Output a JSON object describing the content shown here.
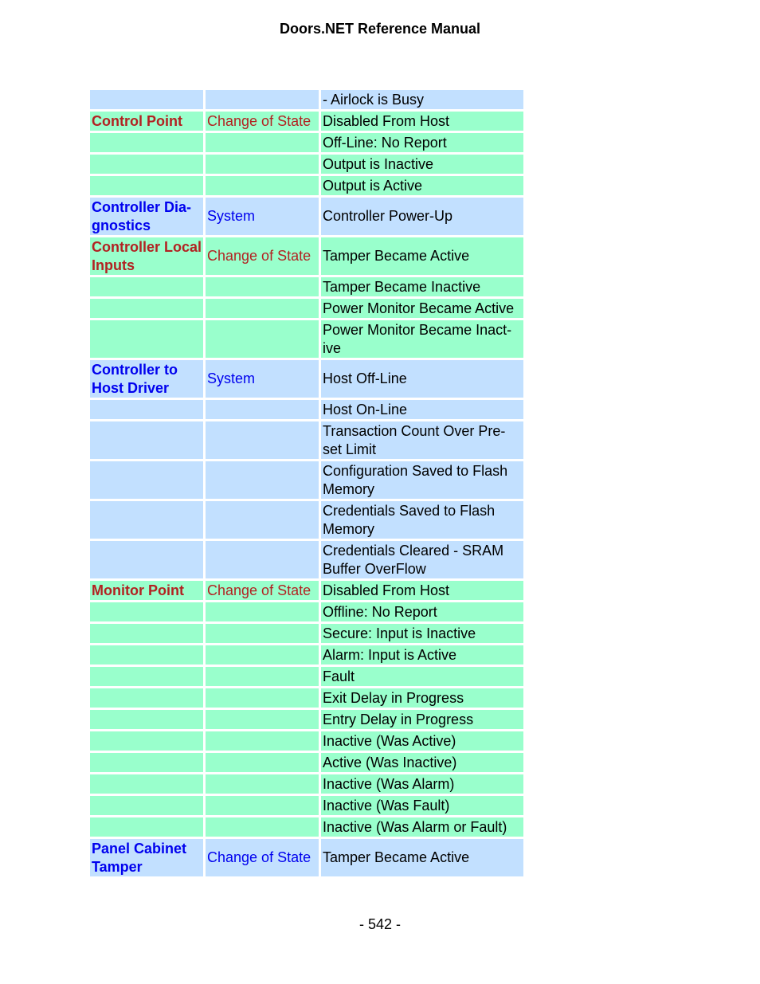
{
  "header": {
    "title": "Doors.NET Reference Manual"
  },
  "footer": {
    "page_number": "- 542 -"
  },
  "colors": {
    "blue_row": "#c2e0ff",
    "green_row": "#99ffcc",
    "red_text": "#b22222",
    "blue_text": "#0000ee"
  },
  "rows": [
    {
      "type": "",
      "category": "",
      "event": "- Airlock is Busy",
      "color": "blue"
    },
    {
      "type": "Control Point",
      "category": "Change of State",
      "event": "Disabled From Host",
      "color": "green"
    },
    {
      "type": "",
      "category": "",
      "event": "Off-Line: No Report",
      "color": "green"
    },
    {
      "type": "",
      "category": "",
      "event": "Output is Inactive",
      "color": "green"
    },
    {
      "type": "",
      "category": "",
      "event": "Output is Active",
      "color": "green"
    },
    {
      "type": "Controller Dia-gnostics",
      "category": "System",
      "event": "Controller Power-Up",
      "color": "blue"
    },
    {
      "type": "Controller Local Inputs",
      "category": "Change of State",
      "event": "Tamper Became Active",
      "color": "green"
    },
    {
      "type": "",
      "category": "",
      "event": "Tamper Became Inactive",
      "color": "green"
    },
    {
      "type": "",
      "category": "",
      "event": "Power Monitor Became Active",
      "color": "green"
    },
    {
      "type": "",
      "category": "",
      "event": "Power Monitor Became Inact-ive",
      "color": "green"
    },
    {
      "type": "Controller to Host Driver",
      "category": "System",
      "event": "Host Off-Line",
      "color": "blue"
    },
    {
      "type": "",
      "category": "",
      "event": "Host On-Line",
      "color": "blue"
    },
    {
      "type": "",
      "category": "",
      "event": "Transaction Count Over Pre-set Limit",
      "color": "blue"
    },
    {
      "type": "",
      "category": "",
      "event": "Configuration Saved to Flash Memory",
      "color": "blue"
    },
    {
      "type": "",
      "category": "",
      "event": "Credentials Saved to Flash Memory",
      "color": "blue"
    },
    {
      "type": "",
      "category": "",
      "event": "Credentials Cleared - SRAM Buffer OverFlow",
      "color": "blue"
    },
    {
      "type": "Monitor Point",
      "category": "Change of State",
      "event": "Disabled From Host",
      "color": "green"
    },
    {
      "type": "",
      "category": "",
      "event": "Offline: No Report",
      "color": "green"
    },
    {
      "type": "",
      "category": "",
      "event": "Secure: Input is Inactive",
      "color": "green"
    },
    {
      "type": "",
      "category": "",
      "event": "Alarm: Input is Active",
      "color": "green"
    },
    {
      "type": "",
      "category": "",
      "event": "Fault",
      "color": "green"
    },
    {
      "type": "",
      "category": "",
      "event": "Exit Delay in Progress",
      "color": "green"
    },
    {
      "type": "",
      "category": "",
      "event": "Entry Delay in Progress",
      "color": "green"
    },
    {
      "type": "",
      "category": "",
      "event": "Inactive (Was Active)",
      "color": "green"
    },
    {
      "type": "",
      "category": "",
      "event": "Active (Was Inactive)",
      "color": "green"
    },
    {
      "type": "",
      "category": "",
      "event": "Inactive (Was Alarm)",
      "color": "green"
    },
    {
      "type": "",
      "category": "",
      "event": "Inactive (Was Fault)",
      "color": "green"
    },
    {
      "type": "",
      "category": "",
      "event": "Inactive (Was Alarm or Fault)",
      "color": "green"
    },
    {
      "type": "Panel Cabinet Tamper",
      "category": "Change of State",
      "event": "Tamper Became Active",
      "color": "blue"
    }
  ]
}
